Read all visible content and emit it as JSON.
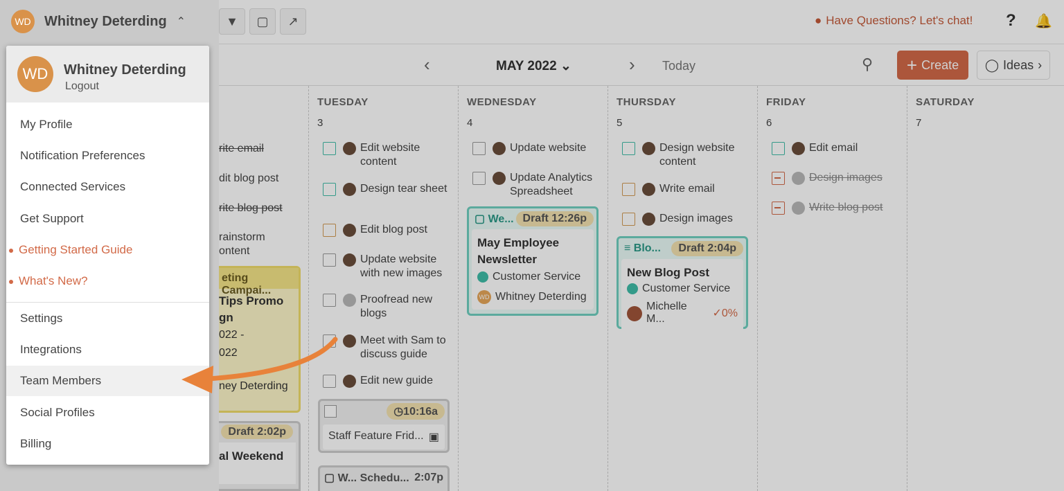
{
  "user": {
    "initials": "WD",
    "name": "Whitney Deterding",
    "logout": "Logout"
  },
  "topbar": {
    "chat": "Have Questions? Let's chat!",
    "help": "?"
  },
  "calendar": {
    "month": "MAY 2022",
    "today": "Today",
    "create": "Create",
    "ideas": "Ideas",
    "days": [
      {
        "name": "TUESDAY",
        "num": "3"
      },
      {
        "name": "WEDNESDAY",
        "num": "4"
      },
      {
        "name": "THURSDAY",
        "num": "5"
      },
      {
        "name": "FRIDAY",
        "num": "6"
      },
      {
        "name": "SATURDAY",
        "num": "7"
      }
    ],
    "monday": {
      "items": [
        "rite email",
        "dit blog post",
        "rite blog post",
        "rainstorm",
        "ontent"
      ],
      "card_title": "eting Campai...",
      "card_lines": [
        "Tips Promo",
        "gn",
        "022 -",
        "022",
        "ney Deterding"
      ],
      "card2_pill": "Draft 2:02p",
      "card2_title": "al Weekend"
    },
    "tuesday": {
      "tasks": [
        "Edit website content",
        "Design tear sheet",
        "Edit blog post",
        "Update website with new images",
        "Proofread new blogs",
        "Meet with Sam to discuss guide",
        "Edit new guide"
      ],
      "card1_time": "10:16a",
      "card1_title": "Staff Feature Frid...",
      "card2_head": "W... Schedu...",
      "card2_time": "2:07p"
    },
    "wednesday": {
      "tasks": [
        "Update website",
        "Update Analytics Spreadsheet"
      ],
      "card_channel": "We...",
      "card_pill": "Draft 12:26p",
      "card_title": "May Employee Newsletter",
      "card_tag": "Customer Service",
      "card_owner": "Whitney Deterding"
    },
    "thursday": {
      "tasks": [
        "Design website content",
        "Write email",
        "Design images"
      ],
      "card_channel": "Blo...",
      "card_pill": "Draft 2:04p",
      "card_title": "New Blog Post",
      "card_tag": "Customer Service",
      "card_owner": "Michelle M...",
      "card_progress": "0%"
    },
    "friday": {
      "tasks": [
        "Edit email",
        "Design images",
        "Write blog post"
      ]
    }
  },
  "menu": {
    "items": [
      "My Profile",
      "Notification Preferences",
      "Connected Services",
      "Get Support",
      "Getting Started Guide",
      "What's New?",
      "Settings",
      "Integrations",
      "Team Members",
      "Social Profiles",
      "Billing"
    ]
  },
  "colors": {
    "accent": "#d26a48",
    "teal": "#3fbca8",
    "highlight_arrow": "#e8823a"
  }
}
